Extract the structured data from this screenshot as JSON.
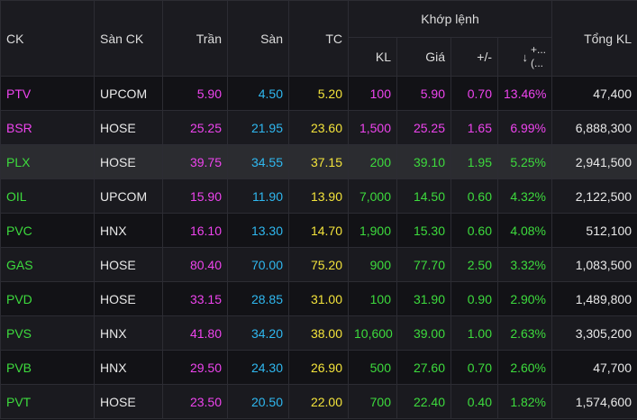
{
  "header": {
    "ck": "CK",
    "san_ck": "Sàn CK",
    "tran": "Trần",
    "san": "Sàn",
    "tc": "TC",
    "khop_lenh": "Khớp lệnh",
    "kl": "KL",
    "gia": "Giá",
    "change": "+/-",
    "sort_arrow": "↓",
    "pct": "+...",
    "pct2": "(...",
    "tong_kl": "Tổng KL"
  },
  "colors": {
    "ceiling": "#ee44ee",
    "floor": "#2fb8f0",
    "ref": "#f3e33b",
    "up": "#3ddb3d"
  },
  "rows": [
    {
      "ck": "PTV",
      "exch": "UPCOM",
      "tran": "5.90",
      "san": "4.50",
      "tc": "5.20",
      "kl": "100",
      "gia": "5.90",
      "chg": "0.70",
      "pct": "13.46%",
      "total": "47,400",
      "state": "ceiling"
    },
    {
      "ck": "BSR",
      "exch": "HOSE",
      "tran": "25.25",
      "san": "21.95",
      "tc": "23.60",
      "kl": "1,500",
      "gia": "25.25",
      "chg": "1.65",
      "pct": "6.99%",
      "total": "6,888,300",
      "state": "ceiling"
    },
    {
      "ck": "PLX",
      "exch": "HOSE",
      "tran": "39.75",
      "san": "34.55",
      "tc": "37.15",
      "kl": "200",
      "gia": "39.10",
      "chg": "1.95",
      "pct": "5.25%",
      "total": "2,941,500",
      "state": "up"
    },
    {
      "ck": "OIL",
      "exch": "UPCOM",
      "tran": "15.90",
      "san": "11.90",
      "tc": "13.90",
      "kl": "7,000",
      "gia": "14.50",
      "chg": "0.60",
      "pct": "4.32%",
      "total": "2,122,500",
      "state": "up"
    },
    {
      "ck": "PVC",
      "exch": "HNX",
      "tran": "16.10",
      "san": "13.30",
      "tc": "14.70",
      "kl": "1,900",
      "gia": "15.30",
      "chg": "0.60",
      "pct": "4.08%",
      "total": "512,100",
      "state": "up"
    },
    {
      "ck": "GAS",
      "exch": "HOSE",
      "tran": "80.40",
      "san": "70.00",
      "tc": "75.20",
      "kl": "900",
      "gia": "77.70",
      "chg": "2.50",
      "pct": "3.32%",
      "total": "1,083,500",
      "state": "up"
    },
    {
      "ck": "PVD",
      "exch": "HOSE",
      "tran": "33.15",
      "san": "28.85",
      "tc": "31.00",
      "kl": "100",
      "gia": "31.90",
      "chg": "0.90",
      "pct": "2.90%",
      "total": "1,489,800",
      "state": "up"
    },
    {
      "ck": "PVS",
      "exch": "HNX",
      "tran": "41.80",
      "san": "34.20",
      "tc": "38.00",
      "kl": "10,600",
      "gia": "39.00",
      "chg": "1.00",
      "pct": "2.63%",
      "total": "3,305,200",
      "state": "up"
    },
    {
      "ck": "PVB",
      "exch": "HNX",
      "tran": "29.50",
      "san": "24.30",
      "tc": "26.90",
      "kl": "500",
      "gia": "27.60",
      "chg": "0.70",
      "pct": "2.60%",
      "total": "47,700",
      "state": "up"
    },
    {
      "ck": "PVT",
      "exch": "HOSE",
      "tran": "23.50",
      "san": "20.50",
      "tc": "22.00",
      "kl": "700",
      "gia": "22.40",
      "chg": "0.40",
      "pct": "1.82%",
      "total": "1,574,600",
      "state": "up"
    }
  ]
}
